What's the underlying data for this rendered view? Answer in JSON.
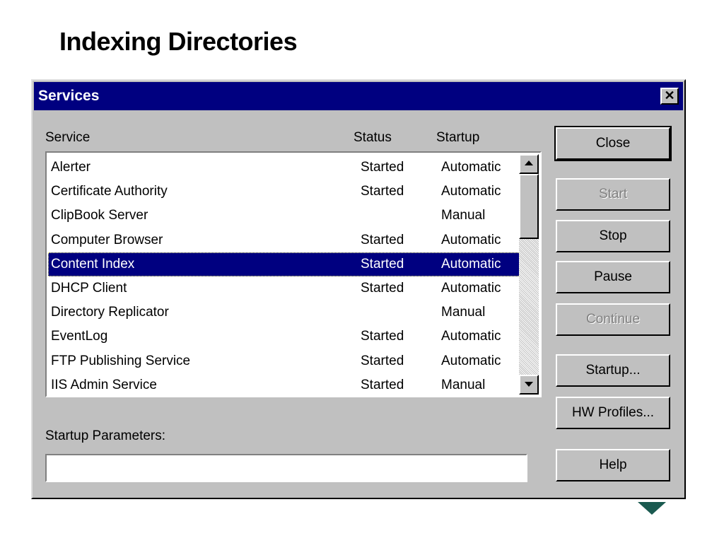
{
  "slide": {
    "title": "Indexing Directories"
  },
  "dialog": {
    "title": "Services",
    "close_glyph": "✕"
  },
  "columns": {
    "service": "Service",
    "status": "Status",
    "startup": "Startup"
  },
  "services": [
    {
      "name": "Alerter",
      "status": "Started",
      "startup": "Automatic",
      "selected": false
    },
    {
      "name": "Certificate Authority",
      "status": "Started",
      "startup": "Automatic",
      "selected": false
    },
    {
      "name": "ClipBook Server",
      "status": "",
      "startup": "Manual",
      "selected": false
    },
    {
      "name": "Computer Browser",
      "status": "Started",
      "startup": "Automatic",
      "selected": false
    },
    {
      "name": "Content Index",
      "status": "Started",
      "startup": "Automatic",
      "selected": true
    },
    {
      "name": "DHCP Client",
      "status": "Started",
      "startup": "Automatic",
      "selected": false
    },
    {
      "name": "Directory Replicator",
      "status": "",
      "startup": "Manual",
      "selected": false
    },
    {
      "name": "EventLog",
      "status": "Started",
      "startup": "Automatic",
      "selected": false
    },
    {
      "name": "FTP Publishing Service",
      "status": "Started",
      "startup": "Automatic",
      "selected": false
    },
    {
      "name": "IIS Admin Service",
      "status": "Started",
      "startup": "Manual",
      "selected": false
    }
  ],
  "buttons": {
    "close": "Close",
    "start": "Start",
    "stop": "Stop",
    "pause": "Pause",
    "continue": "Continue",
    "startup": "Startup...",
    "hw_profiles": "HW Profiles...",
    "help": "Help"
  },
  "startup_params": {
    "label": "Startup Parameters:",
    "value": ""
  },
  "colors": {
    "titlebar": "#000080",
    "selection": "#000080",
    "dialog_face": "#c0c0c0",
    "nav_arrow": "#1a5a50"
  },
  "icons": {
    "scroll_up": "arrow-up-icon",
    "scroll_down": "arrow-down-icon",
    "next_slide": "triangle-down-icon"
  }
}
